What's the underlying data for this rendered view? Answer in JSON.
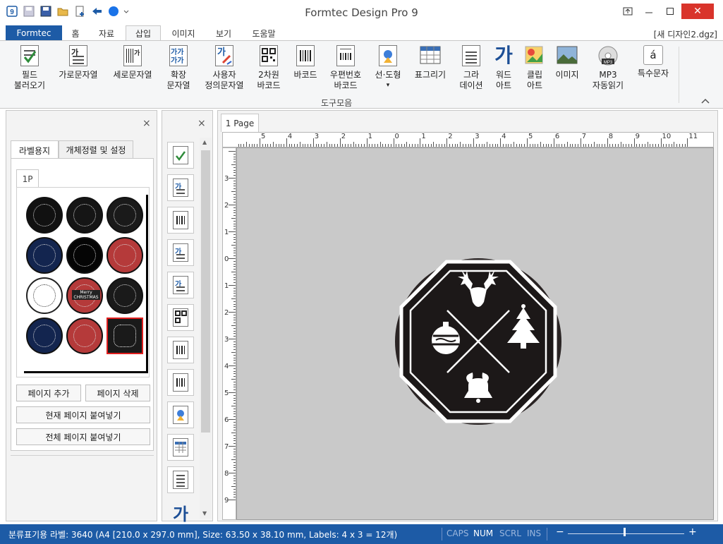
{
  "window": {
    "title": "Formtec Design Pro 9",
    "quick_access": [
      "app-icon",
      "save-icon",
      "save-as-icon",
      "open-folder-icon",
      "new-document-icon",
      "undo-arrow-icon",
      "circle-icon",
      "dropdown-icon"
    ],
    "controls": {
      "restore": "⧉",
      "minimize": "—",
      "maximize": "☐",
      "close": "✕",
      "ribbon_mode": "⊡"
    }
  },
  "ribbon_tabs": {
    "formtec": "Formtec",
    "tabs": [
      "홈",
      "자료",
      "삽입",
      "이미지",
      "보기",
      "도움말"
    ],
    "active": "삽입",
    "document": "[새 디자인2.dgz]"
  },
  "ribbon": {
    "group_label": "도구모음",
    "collapse_icon": "chevron-up-icon",
    "items": [
      {
        "label1": "필드",
        "label2": "불러오기",
        "icon": "field-import-icon"
      },
      {
        "label1": "가로문자열",
        "label2": "",
        "icon": "horizontal-text-icon"
      },
      {
        "label1": "세로문자열",
        "label2": "",
        "icon": "vertical-text-icon"
      },
      {
        "label1": "확장",
        "label2": "문자열",
        "icon": "extended-text-icon"
      },
      {
        "label1": "사용자",
        "label2": "정의문자열",
        "icon": "custom-text-icon"
      },
      {
        "label1": "2차원",
        "label2": "바코드",
        "icon": "qr-code-icon"
      },
      {
        "label1": "바코드",
        "label2": "",
        "icon": "barcode-icon"
      },
      {
        "label1": "우편번호",
        "label2": "바코드",
        "icon": "postal-barcode-icon"
      },
      {
        "label1": "선·도형",
        "label2": "▾",
        "icon": "shape-icon"
      },
      {
        "label1": "표그리기",
        "label2": "",
        "icon": "table-icon"
      },
      {
        "label1": "그라",
        "label2": "데이션",
        "icon": "gradation-icon"
      },
      {
        "label1": "워드",
        "label2": "아트",
        "icon": "word-art-icon"
      },
      {
        "label1": "클립",
        "label2": "아트",
        "icon": "clip-art-icon"
      },
      {
        "label1": "이미지",
        "label2": "",
        "icon": "image-icon"
      },
      {
        "label1": "MP3",
        "label2": "자동읽기",
        "icon": "mp3-icon"
      },
      {
        "label1": "특수문자",
        "label2": "",
        "icon": "special-char-icon"
      }
    ],
    "wordart_glyph": "가",
    "special_glyph": "á",
    "mp3_badge": "MP3"
  },
  "left_panel": {
    "close": "×",
    "tabs": [
      "라벨용지",
      "개체정렬 및 설정"
    ],
    "active_tab": "라벨용지",
    "page_tab": "1P",
    "buttons": {
      "add_page": "페이지 추가",
      "delete_page": "페이지 삭제",
      "paste_current": "현재 페이지 붙여넣기",
      "paste_all": "전체 페이지 붙여넣기"
    },
    "thumbnail_labels": [
      {
        "fill": "#111111"
      },
      {
        "fill": "#151515"
      },
      {
        "fill": "#1a1a1a"
      },
      {
        "fill": "#13254f"
      },
      {
        "fill": "#050505"
      },
      {
        "fill": "#b53a3a"
      },
      {
        "fill": "#ffffff"
      },
      {
        "fill": "#b53a3a"
      },
      {
        "fill": "#1a1a1a"
      },
      {
        "fill": "#13254f"
      },
      {
        "fill": "#b53a3a"
      },
      {
        "fill": "#1a1a1a"
      }
    ],
    "selected_label_index": 11,
    "thumb_texts": {
      "merry": "Merry",
      "christmas": "CHRISTMAS"
    }
  },
  "tool_strip": {
    "close": "×",
    "scroll_up": "▲",
    "scroll_down": "▼",
    "glyph": "가",
    "tools": [
      "field-import-icon",
      "horizontal-text-icon",
      "vertical-text-icon",
      "extended-text-icon",
      "custom-text-icon",
      "qr-code-icon",
      "barcode-icon",
      "postal-barcode-icon",
      "shape-icon",
      "table-icon",
      "gradation-icon",
      "word-art-icon"
    ]
  },
  "canvas": {
    "page_tab": "1 Page",
    "ruler_top": [
      "5",
      "4",
      "3",
      "2",
      "1",
      "0",
      "1",
      "2",
      "3",
      "4",
      "5",
      "6",
      "7",
      "8",
      "9",
      "10",
      "11"
    ],
    "ruler_left": [
      "3",
      "2",
      "1",
      "0",
      "1",
      "2",
      "3",
      "4",
      "5",
      "6",
      "7",
      "8",
      "9"
    ]
  },
  "status": {
    "text": "분류표기용 라벨: 3640 (A4 [210.0 x 297.0 mm], Size: 63.50 x 38.10 mm,  Labels: 4 x 3 = 12개)",
    "caps": "CAPS",
    "num": "NUM",
    "scrl": "SCRL",
    "ins": "INS",
    "zoom_minus": "−",
    "zoom_plus": "+"
  }
}
